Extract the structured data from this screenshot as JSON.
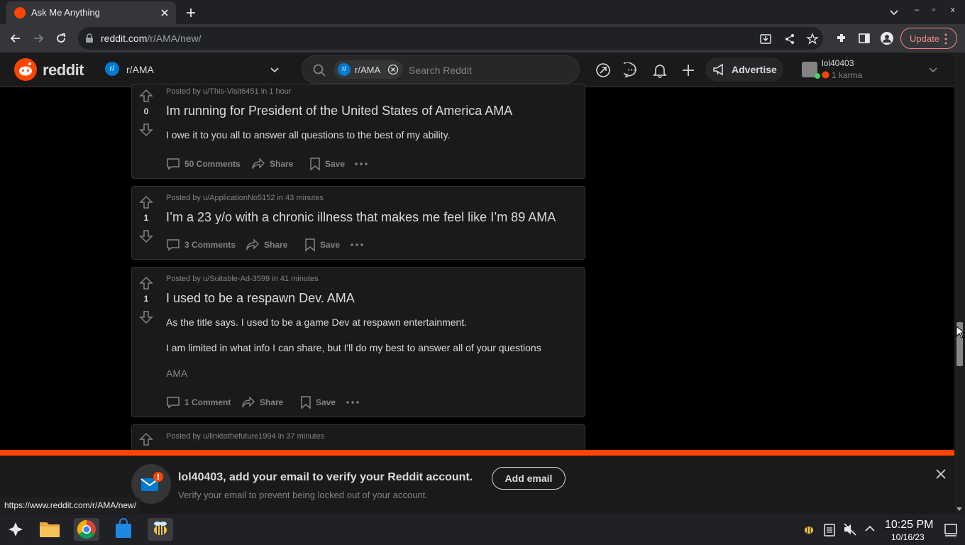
{
  "browser": {
    "tab_title": "Ask Me Anything",
    "url_host": "reddit.com",
    "url_path": "/r/AMA/new/",
    "update_label": "Update",
    "status_url": "https://www.reddit.com/r/AMA/new/",
    "window_controls": [
      "–",
      "▫",
      "x"
    ]
  },
  "reddit_header": {
    "logo_text": "reddit",
    "community": "r/AMA",
    "community_icon": "r/",
    "search_chip": "r/AMA",
    "search_placeholder": "Search Reddit",
    "advertise_label": "Advertise",
    "username": "lol40403",
    "karma": "1 karma"
  },
  "posts": [
    {
      "votes": "0",
      "meta": "Posted by u/This-Visit6451 in 1 hour",
      "title": "Im running for President of the United States of America AMA",
      "body": [
        "I owe it to you all to answer all questions to the best of my ability."
      ],
      "comments": "50 Comments",
      "share": "Share",
      "save": "Save"
    },
    {
      "votes": "1",
      "meta": "Posted by u/ApplicationNo5152 in 43 minutes",
      "title": "I’m a 23 y/o with a chronic illness that makes me feel like I’m 89 AMA",
      "body": [],
      "comments": "3 Comments",
      "share": "Share",
      "save": "Save"
    },
    {
      "votes": "1",
      "meta": "Posted by u/Suitable-Ad-3599 in 41 minutes",
      "title": "I used to be a respawn Dev. AMA",
      "body": [
        "As the title says. I used to be a game Dev at respawn entertainment.",
        "I am limited in what info I can share, but I'll do my best to answer all of your questions",
        "AMA"
      ],
      "comments": "1 Comment",
      "share": "Share",
      "save": "Save"
    },
    {
      "meta": "Posted by u/linktothefuture1994 in 37 minutes"
    }
  ],
  "banner": {
    "title": "lol40403, add your email to verify your Reddit account.",
    "subtitle": "Verify your email to prevent being locked out of your account.",
    "button": "Add email"
  },
  "taskbar": {
    "time": "10:25 PM",
    "date": "10/16/23"
  },
  "colors": {
    "accent": "#ff4500",
    "background": "#000000",
    "card": "#1a1a1b"
  }
}
